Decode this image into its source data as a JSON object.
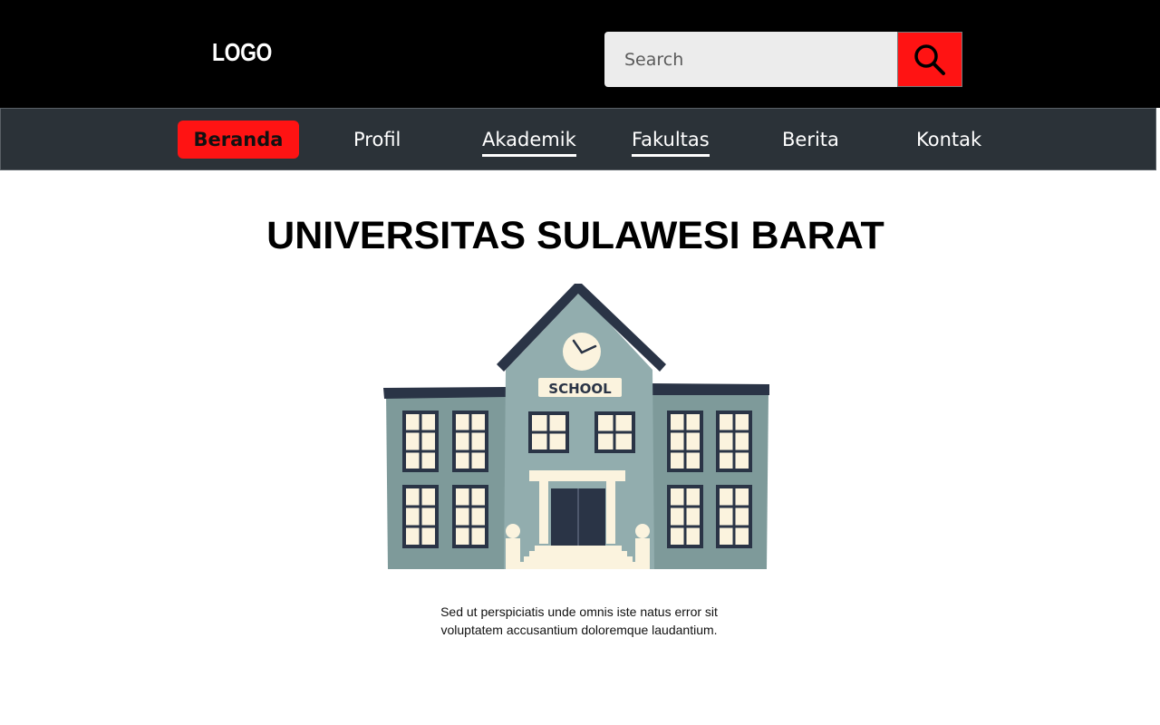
{
  "header": {
    "logo_text": "LOGO",
    "search": {
      "placeholder": "Search",
      "value": ""
    },
    "search_button_icon": "search-icon"
  },
  "nav": {
    "items": [
      {
        "label": "Beranda",
        "active": true
      },
      {
        "label": "Profil"
      },
      {
        "label": "Akademik"
      },
      {
        "label": "Fakultas"
      },
      {
        "label": "Berita"
      },
      {
        "label": "Kontak"
      }
    ]
  },
  "main": {
    "title": "UNIVERSITAS SULAWESI BARAT",
    "illustration": {
      "icon": "school-building-illustration",
      "sign_text": "SCHOOL"
    },
    "caption": "Sed ut perspiciatis unde omnis iste natus error sit voluptatem accusantium doloremque laudantium."
  },
  "colors": {
    "topbar": "#000000",
    "navbar": "#2b3238",
    "accent": "#ff1313",
    "search_bg": "#ececec"
  }
}
